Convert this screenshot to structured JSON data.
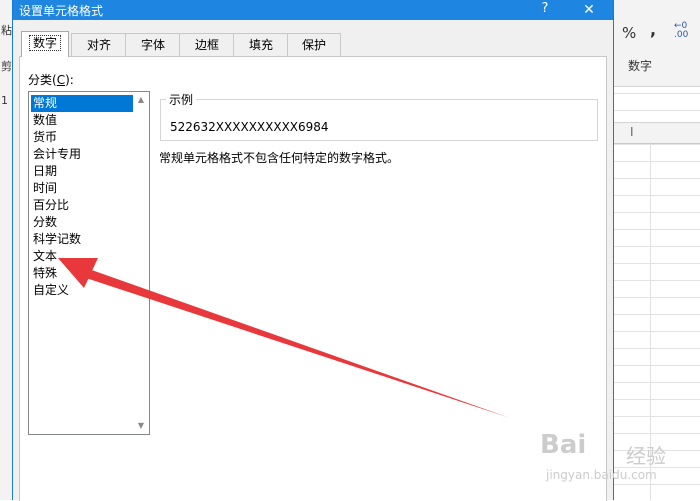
{
  "dialog": {
    "title": "设置单元格格式",
    "help_label": "?",
    "close_label": "✕",
    "tabs": [
      {
        "label": "数字",
        "active": true
      },
      {
        "label": "对齐",
        "active": false
      },
      {
        "label": "字体",
        "active": false
      },
      {
        "label": "边框",
        "active": false
      },
      {
        "label": "填充",
        "active": false
      },
      {
        "label": "保护",
        "active": false
      }
    ],
    "category_label": "分类(",
    "category_hotkey": "C",
    "category_label_end": "):",
    "categories": [
      "常规",
      "数值",
      "货币",
      "会计专用",
      "日期",
      "时间",
      "百分比",
      "分数",
      "科学记数",
      "文本",
      "特殊",
      "自定义"
    ],
    "selected_category": "常规",
    "sample_legend": "示例",
    "sample_value": "522632XXXXXXXXXX6984",
    "description": "常规单元格格式不包含任何特定的数字格式。",
    "scroll_up": "▲",
    "scroll_down": "▼"
  },
  "background": {
    "left_fragments": [
      "粘",
      "剪",
      "1"
    ],
    "ribbon_percent": "%",
    "ribbon_comma": ",",
    "ribbon_decimal_top": "←0",
    "ribbon_decimal_bottom": ".00",
    "ribbon_group": "数字",
    "column_header": "I"
  },
  "annotation": {
    "color": "#e8383b"
  },
  "watermark": {
    "logo": "Bai",
    "cn": "经验",
    "url": "jingyan.baidu.com"
  },
  "colors": {
    "titlebar": "#1e86e0",
    "selection": "#0078d7"
  }
}
